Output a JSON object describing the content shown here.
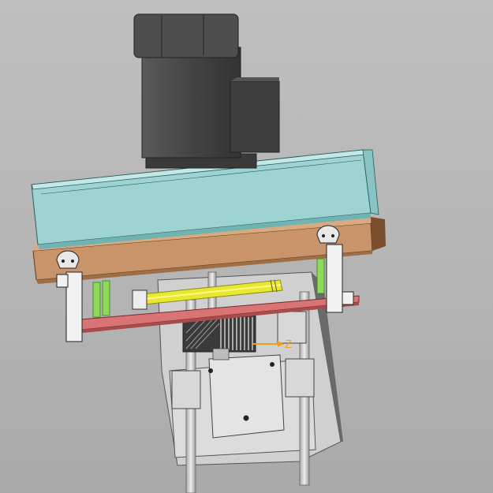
{
  "viewport": {
    "background": "#b8b8b8"
  },
  "triad": {
    "axis_label": "Z",
    "color": "#f0a020"
  },
  "colors": {
    "motor": "#4a4a4a",
    "gearbox_cover": "#9ed3d3",
    "wood_block": "#c9946a",
    "red_plate": "#d97070",
    "yellow_shaft": "#e8e830",
    "green_standoff": "#8ed85a",
    "frame_gray": "#d6d6d6"
  }
}
